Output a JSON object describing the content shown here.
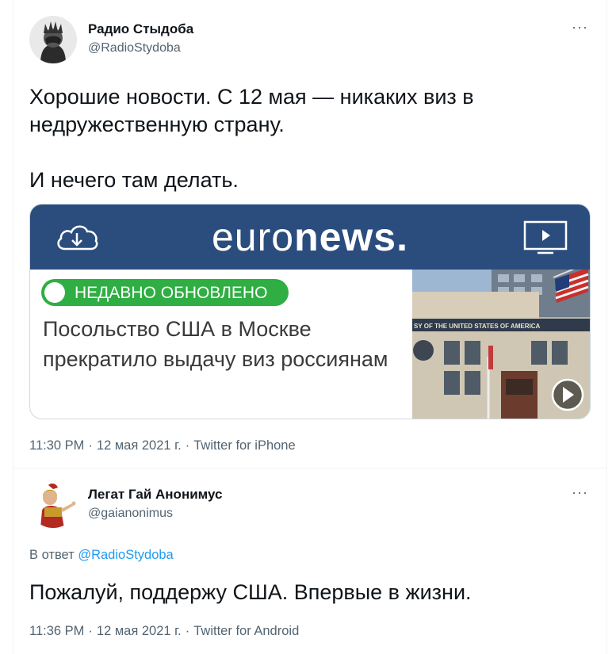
{
  "tweets": [
    {
      "author": {
        "name": "Радио Стыдоба",
        "handle": "@RadioStydoba"
      },
      "text_lines": [
        "Хорошие новости. С 12 мая — никаких виз в",
        "недружественную страну.",
        "",
        "И нечего там делать."
      ],
      "card": {
        "brand_light": "euro",
        "brand_bold": "news.",
        "badge": "НЕДАВНО ОБНОВЛЕНО",
        "headline": "Посольство США в Москве прекратило выдачу виз россиянам",
        "sign_text": "SY OF THE UNITED STATES OF AMERICA",
        "colors": {
          "header": "#2b4d7e",
          "badge": "#2fae43"
        },
        "icons": [
          "cloud-download-icon",
          "tv-play-icon",
          "video-play-icon",
          "us-flag-icon"
        ]
      },
      "meta": {
        "time": "11:30 PM",
        "date": "12 мая 2021 г.",
        "source": "Twitter for iPhone"
      }
    },
    {
      "author": {
        "name": "Легат Гай Анонимус",
        "handle": "@gaianonimus"
      },
      "reply_prefix": "В ответ",
      "reply_handle": "@RadioStydoba",
      "text": "Пожалуй, поддержу США. Впервые в жизни.",
      "meta": {
        "time": "11:36 PM",
        "date": "12 мая 2021 г.",
        "source": "Twitter for Android"
      }
    }
  ],
  "ui": {
    "more": "···",
    "separator": "·"
  },
  "colors": {
    "text": "#0f1419",
    "secondary": "#536471",
    "link": "#1d9bf0"
  }
}
